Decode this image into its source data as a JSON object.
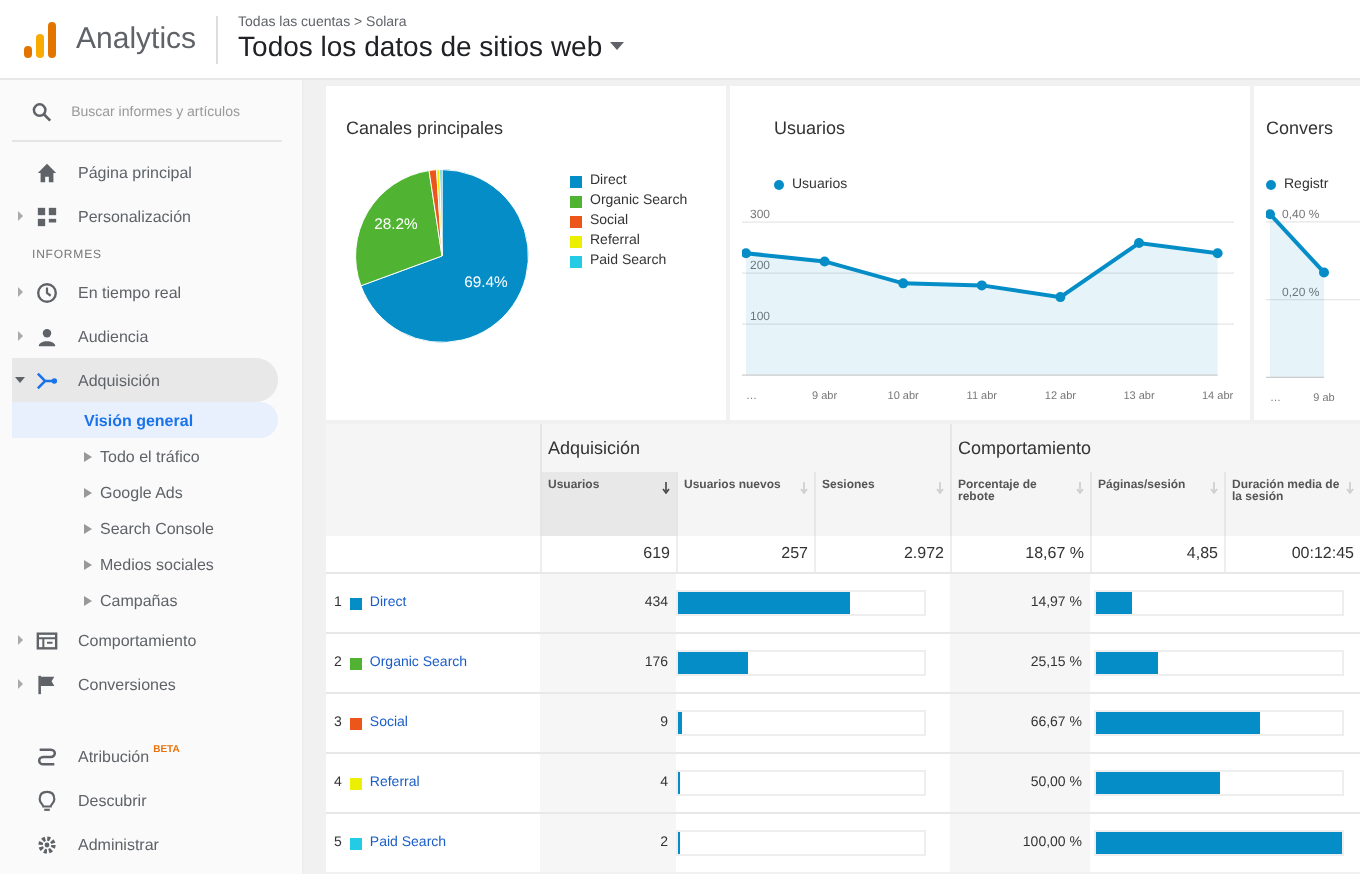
{
  "header": {
    "logo_text": "Analytics",
    "breadcrumb": "Todas las cuentas > Solara",
    "title": "Todos los datos de sitios web"
  },
  "sidebar": {
    "search": {
      "placeholder": "Buscar informes y artículos"
    },
    "items": [
      {
        "kind": "item",
        "label": "Página principal",
        "selected": false
      },
      {
        "kind": "item",
        "label": "Personalización",
        "selected": false,
        "expanded": false
      },
      {
        "kind": "section",
        "label": "INFORMES"
      },
      {
        "kind": "item",
        "label": "En tiempo real",
        "selected": false,
        "expanded": false
      },
      {
        "kind": "item",
        "label": "Audiencia",
        "selected": false,
        "expanded": false
      },
      {
        "kind": "item",
        "label": "Adquisición",
        "selected": true,
        "expanded": true,
        "children": [
          {
            "label": "Visión general",
            "selected": true
          },
          {
            "label": "Todo el tráfico",
            "selected": false,
            "expanded": false
          },
          {
            "label": "Google Ads",
            "selected": false,
            "expanded": false
          },
          {
            "label": "Search Console",
            "selected": false,
            "expanded": false
          },
          {
            "label": "Medios sociales",
            "selected": false,
            "expanded": false
          },
          {
            "label": "Campañas",
            "selected": false,
            "expanded": false
          }
        ]
      },
      {
        "kind": "item",
        "label": "Comportamiento",
        "selected": false,
        "expanded": false
      },
      {
        "kind": "item",
        "label": "Conversiones",
        "selected": false,
        "expanded": false
      }
    ],
    "bottom_items": [
      {
        "label": "Atribución",
        "badge": "BETA"
      },
      {
        "label": "Descubrir"
      },
      {
        "label": "Administrar"
      }
    ]
  },
  "cards": [
    {
      "title": "Canales principales",
      "chart_data": {
        "type": "pie",
        "categories": [
          "Direct",
          "Organic Search",
          "Social",
          "Referral",
          "Paid Search"
        ],
        "values": [
          69.4,
          28.2,
          1.4,
          0.6,
          0.4
        ],
        "colors": [
          "#058dc7",
          "#50b432",
          "#ed561b",
          "#edef00",
          "#24cbe5"
        ],
        "value_labels": [
          "69.4%",
          "28.2%",
          null,
          null,
          null
        ]
      }
    },
    {
      "title": "Usuarios",
      "chart_data": {
        "type": "area",
        "categories": [
          "…",
          "9 abr",
          "10 abr",
          "11 abr",
          "12 abr",
          "13 abr",
          "14 abr"
        ],
        "series": [
          {
            "name": "Usuarios",
            "color": "#058dc7",
            "values": [
              239,
              223,
              180,
              176,
              153,
              259,
              239
            ]
          }
        ],
        "ylim": [
          -88,
          567
        ],
        "yticks": [
          100,
          200,
          300
        ],
        "grid": true
      }
    },
    {
      "title": "Convers",
      "chart_data": {
        "type": "area",
        "categories": [
          "…",
          "9 ab"
        ],
        "series": [
          {
            "name": "Registr",
            "color": "#058dc7",
            "values": [
              0.42,
              0.27
            ]
          }
        ],
        "ylim": [
          -0.11,
          0.75
        ],
        "grid": true,
        "yticks": [
          {
            "value": 0.2,
            "label": "0,20 %"
          },
          {
            "value": 0.4,
            "label": "0,40 %"
          }
        ]
      }
    }
  ],
  "table": {
    "groups": [
      "Adquisición",
      "Comportamiento"
    ],
    "columns": [
      {
        "label": "Usuarios",
        "sorted": true
      },
      {
        "label": "Usuarios nuevos",
        "sorted": false
      },
      {
        "label": "Sesiones",
        "sorted": false
      },
      {
        "label": "Porcentaje de rebote",
        "sorted": false
      },
      {
        "label": "Páginas/sesión",
        "sorted": false
      },
      {
        "label": "Duración media de la sesión",
        "sorted": false
      }
    ],
    "totals": [
      "619",
      "257",
      "2.972",
      "18,67 %",
      "4,85",
      "00:12:45"
    ],
    "rows": [
      {
        "rank": "1",
        "name": "Direct",
        "color": "#058dc7",
        "users": "434",
        "users_bar": {
          "level": 0.7
        },
        "bounce": "14,97 %",
        "bounce_bar": {
          "level": 0.15
        }
      },
      {
        "rank": "2",
        "name": "Organic Search",
        "color": "#50b432",
        "users": "176",
        "users_bar": {
          "level": 0.284
        },
        "bounce": "25,15 %",
        "bounce_bar": {
          "level": 0.25
        }
      },
      {
        "rank": "3",
        "name": "Social",
        "color": "#ed561b",
        "users": "9",
        "users_bar": {
          "level": 0.015
        },
        "bounce": "66,67 %",
        "bounce_bar": {
          "level": 0.667
        }
      },
      {
        "rank": "4",
        "name": "Referral",
        "color": "#edef00",
        "users": "4",
        "users_bar": {
          "level": 0.006
        },
        "bounce": "50,00 %",
        "bounce_bar": {
          "level": 0.5
        }
      },
      {
        "rank": "5",
        "name": "Paid Search",
        "color": "#24cbe5",
        "users": "2",
        "users_bar": {
          "level": 0.003
        },
        "bounce": "100,00 %",
        "bounce_bar": {
          "level": 1.0
        }
      }
    ]
  }
}
